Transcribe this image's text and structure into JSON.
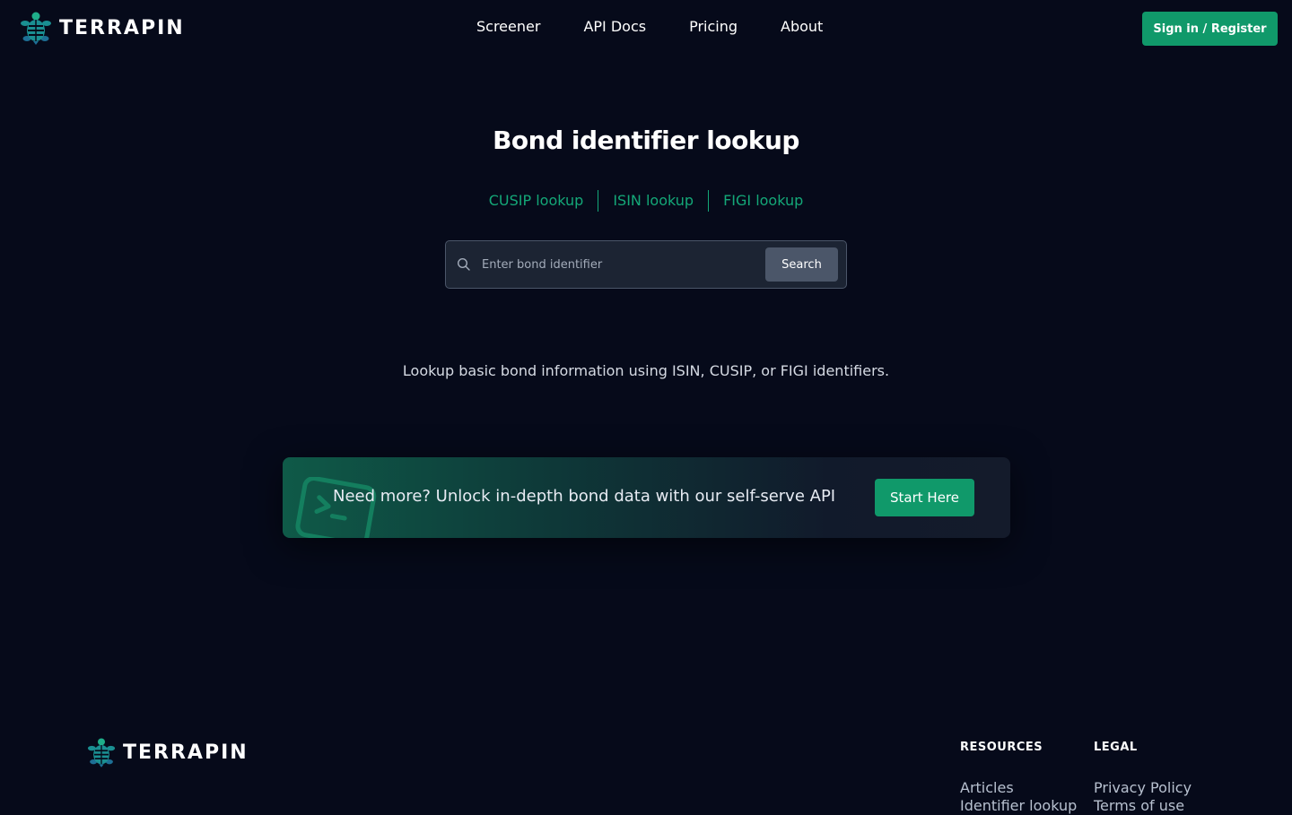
{
  "header": {
    "logo_text": "TERRAPIN",
    "nav": [
      "Screener",
      "API Docs",
      "Pricing",
      "About"
    ],
    "signin_label": "Sign in / Register"
  },
  "main": {
    "title": "Bond identifier lookup",
    "lookup_links": [
      "CUSIP lookup",
      "ISIN lookup",
      "FIGI lookup"
    ],
    "search": {
      "placeholder": "Enter bond identifier",
      "value": "",
      "button_label": "Search"
    },
    "description": "Lookup basic bond information using ISIN, CUSIP, or FIGI identifiers."
  },
  "cta": {
    "text": "Need more? Unlock in-depth bond data with our self-serve API",
    "button_label": "Start Here"
  },
  "footer": {
    "logo_text": "TERRAPIN",
    "columns": [
      {
        "heading": "RESOURCES",
        "links": [
          "Articles",
          "Identifier lookup"
        ]
      },
      {
        "heading": "LEGAL",
        "links": [
          "Privacy Policy",
          "Terms of use"
        ]
      }
    ]
  },
  "colors": {
    "background": "#060a1a",
    "accent": "#10996a",
    "link": "#14a878",
    "search_bg": "#1c2433",
    "search_button": "#4b5669"
  },
  "icons": [
    "turtle-logo-icon",
    "search-icon",
    "terminal-icon"
  ]
}
